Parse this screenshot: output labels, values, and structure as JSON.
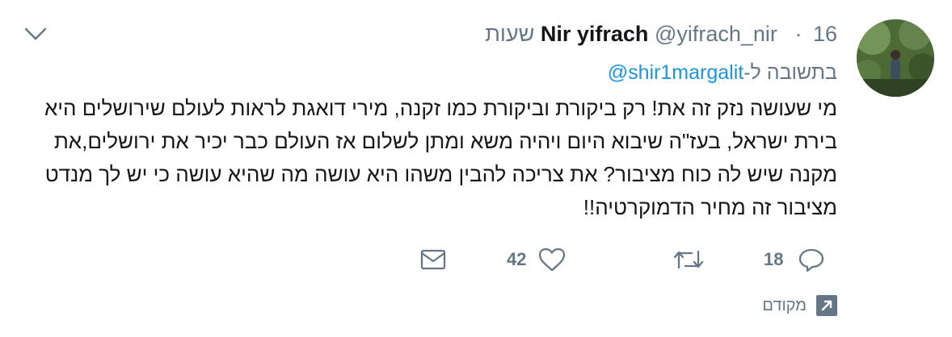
{
  "tweet": {
    "author_name": "Nir yifrach",
    "author_handle": "@yifrach_nir",
    "separator": "·",
    "time": "16 שעות",
    "reply_prefix": "בתשובה ל-",
    "reply_to": "@shir1margalit",
    "lines": [
      "מי שעושה נזק זה את! רק ביקורת וביקורת כמו זקנה, מירי דואגת לראות לעולם שירושלים היא",
      "בירת ישראל, בעז\"ה שיבוא היום ויהיה משא ומתן לשלום אז העולם כבר יכיר את ירושלים,את",
      "מקנה שיש לה כוח מציבור? את צריכה להבין משהו היא עושה מה שהיא עושה כי יש לך מנדט",
      "מציבור זה מחיר הדמוקרטיה!!"
    ]
  },
  "actions": {
    "reply_count": "18",
    "retweet_count": "",
    "like_count": "42"
  },
  "promoted": {
    "label": "מקודם"
  },
  "icons": {
    "menu": "chevron-down-icon",
    "reply": "reply-bubble-icon",
    "retweet": "retweet-icon",
    "like": "heart-icon",
    "message": "envelope-icon",
    "promoted": "promoted-arrow-icon"
  },
  "colors": {
    "link": "#1b95e0",
    "secondary": "#657786",
    "text": "#14171a"
  }
}
